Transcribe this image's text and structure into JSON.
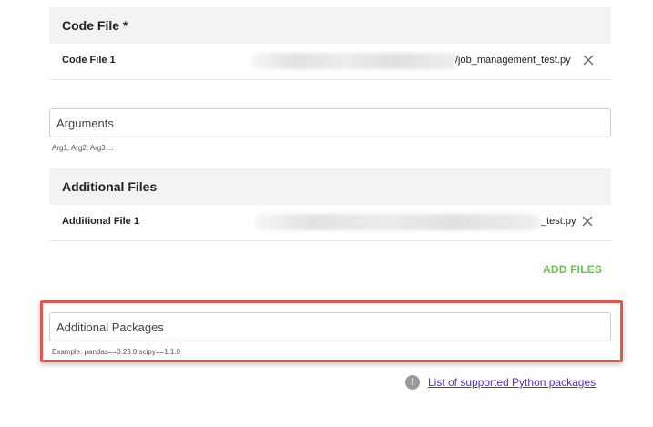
{
  "code_file": {
    "header": "Code File *",
    "rows": [
      {
        "label": "Code File 1",
        "file_name": "/job_management_test.py"
      }
    ]
  },
  "arguments": {
    "placeholder": "Arguments",
    "hint": "Arg1, Arg2, Arg3 ..."
  },
  "additional_files": {
    "header": "Additional Files",
    "rows": [
      {
        "label": "Additional File 1",
        "file_name": "_test.py"
      }
    ],
    "add_label": "ADD FILES"
  },
  "additional_packages": {
    "placeholder": "Additional Packages",
    "hint": "Example: pandas==0.23.0 scipy==1.1.0"
  },
  "supported_packages": {
    "icon": "info-icon",
    "link_label": "List of supported Python packages"
  },
  "colors": {
    "accent_green": "#6cc04a",
    "highlight_red": "#e8554a",
    "link_purple": "#5b2bb5"
  }
}
